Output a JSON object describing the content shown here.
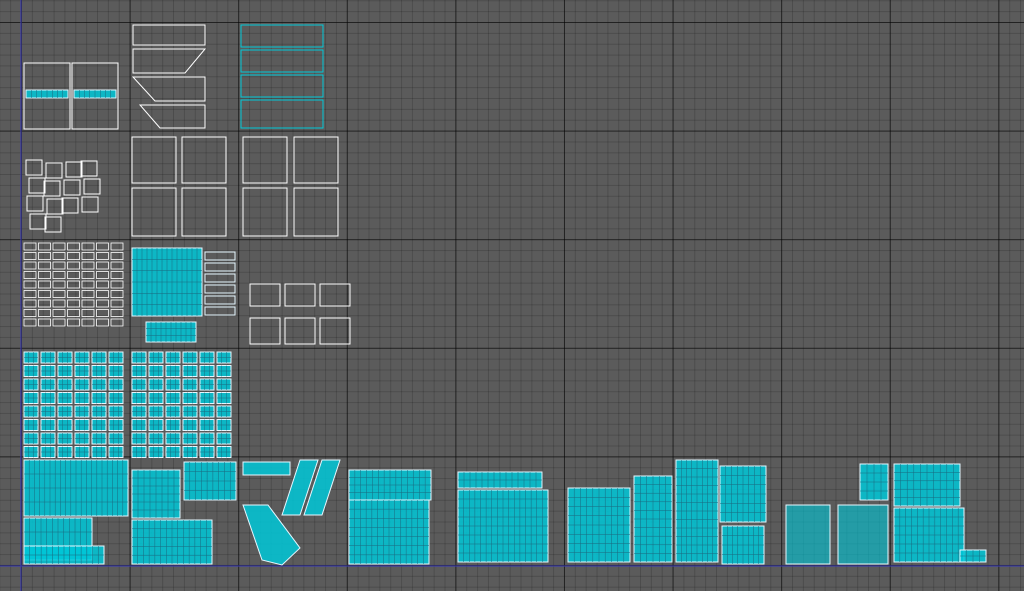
{
  "editor": {
    "view": "UV Editor"
  },
  "colors": {
    "grid_minor": "#6a6a6a",
    "grid_major": "#1f1f1f",
    "background": "#5b5b5b",
    "uv_fill": "#00c8d8",
    "uv_edge": "#e6f7ff",
    "shell_outline": "#ffffff",
    "axis": "#3b3bb0"
  },
  "icons": [
    "grid-icon",
    "uv-shell-icon"
  ]
}
